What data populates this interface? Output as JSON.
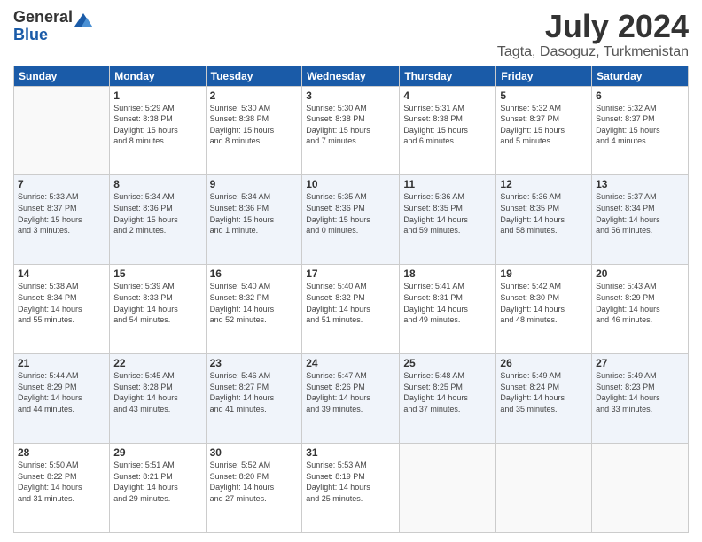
{
  "logo": {
    "general": "General",
    "blue": "Blue"
  },
  "header": {
    "month": "July 2024",
    "location": "Tagta, Dasoguz, Turkmenistan"
  },
  "weekdays": [
    "Sunday",
    "Monday",
    "Tuesday",
    "Wednesday",
    "Thursday",
    "Friday",
    "Saturday"
  ],
  "weeks": [
    [
      {
        "day": "",
        "info": ""
      },
      {
        "day": "1",
        "info": "Sunrise: 5:29 AM\nSunset: 8:38 PM\nDaylight: 15 hours\nand 8 minutes."
      },
      {
        "day": "2",
        "info": "Sunrise: 5:30 AM\nSunset: 8:38 PM\nDaylight: 15 hours\nand 8 minutes."
      },
      {
        "day": "3",
        "info": "Sunrise: 5:30 AM\nSunset: 8:38 PM\nDaylight: 15 hours\nand 7 minutes."
      },
      {
        "day": "4",
        "info": "Sunrise: 5:31 AM\nSunset: 8:38 PM\nDaylight: 15 hours\nand 6 minutes."
      },
      {
        "day": "5",
        "info": "Sunrise: 5:32 AM\nSunset: 8:37 PM\nDaylight: 15 hours\nand 5 minutes."
      },
      {
        "day": "6",
        "info": "Sunrise: 5:32 AM\nSunset: 8:37 PM\nDaylight: 15 hours\nand 4 minutes."
      }
    ],
    [
      {
        "day": "7",
        "info": "Sunrise: 5:33 AM\nSunset: 8:37 PM\nDaylight: 15 hours\nand 3 minutes."
      },
      {
        "day": "8",
        "info": "Sunrise: 5:34 AM\nSunset: 8:36 PM\nDaylight: 15 hours\nand 2 minutes."
      },
      {
        "day": "9",
        "info": "Sunrise: 5:34 AM\nSunset: 8:36 PM\nDaylight: 15 hours\nand 1 minute."
      },
      {
        "day": "10",
        "info": "Sunrise: 5:35 AM\nSunset: 8:36 PM\nDaylight: 15 hours\nand 0 minutes."
      },
      {
        "day": "11",
        "info": "Sunrise: 5:36 AM\nSunset: 8:35 PM\nDaylight: 14 hours\nand 59 minutes."
      },
      {
        "day": "12",
        "info": "Sunrise: 5:36 AM\nSunset: 8:35 PM\nDaylight: 14 hours\nand 58 minutes."
      },
      {
        "day": "13",
        "info": "Sunrise: 5:37 AM\nSunset: 8:34 PM\nDaylight: 14 hours\nand 56 minutes."
      }
    ],
    [
      {
        "day": "14",
        "info": "Sunrise: 5:38 AM\nSunset: 8:34 PM\nDaylight: 14 hours\nand 55 minutes."
      },
      {
        "day": "15",
        "info": "Sunrise: 5:39 AM\nSunset: 8:33 PM\nDaylight: 14 hours\nand 54 minutes."
      },
      {
        "day": "16",
        "info": "Sunrise: 5:40 AM\nSunset: 8:32 PM\nDaylight: 14 hours\nand 52 minutes."
      },
      {
        "day": "17",
        "info": "Sunrise: 5:40 AM\nSunset: 8:32 PM\nDaylight: 14 hours\nand 51 minutes."
      },
      {
        "day": "18",
        "info": "Sunrise: 5:41 AM\nSunset: 8:31 PM\nDaylight: 14 hours\nand 49 minutes."
      },
      {
        "day": "19",
        "info": "Sunrise: 5:42 AM\nSunset: 8:30 PM\nDaylight: 14 hours\nand 48 minutes."
      },
      {
        "day": "20",
        "info": "Sunrise: 5:43 AM\nSunset: 8:29 PM\nDaylight: 14 hours\nand 46 minutes."
      }
    ],
    [
      {
        "day": "21",
        "info": "Sunrise: 5:44 AM\nSunset: 8:29 PM\nDaylight: 14 hours\nand 44 minutes."
      },
      {
        "day": "22",
        "info": "Sunrise: 5:45 AM\nSunset: 8:28 PM\nDaylight: 14 hours\nand 43 minutes."
      },
      {
        "day": "23",
        "info": "Sunrise: 5:46 AM\nSunset: 8:27 PM\nDaylight: 14 hours\nand 41 minutes."
      },
      {
        "day": "24",
        "info": "Sunrise: 5:47 AM\nSunset: 8:26 PM\nDaylight: 14 hours\nand 39 minutes."
      },
      {
        "day": "25",
        "info": "Sunrise: 5:48 AM\nSunset: 8:25 PM\nDaylight: 14 hours\nand 37 minutes."
      },
      {
        "day": "26",
        "info": "Sunrise: 5:49 AM\nSunset: 8:24 PM\nDaylight: 14 hours\nand 35 minutes."
      },
      {
        "day": "27",
        "info": "Sunrise: 5:49 AM\nSunset: 8:23 PM\nDaylight: 14 hours\nand 33 minutes."
      }
    ],
    [
      {
        "day": "28",
        "info": "Sunrise: 5:50 AM\nSunset: 8:22 PM\nDaylight: 14 hours\nand 31 minutes."
      },
      {
        "day": "29",
        "info": "Sunrise: 5:51 AM\nSunset: 8:21 PM\nDaylight: 14 hours\nand 29 minutes."
      },
      {
        "day": "30",
        "info": "Sunrise: 5:52 AM\nSunset: 8:20 PM\nDaylight: 14 hours\nand 27 minutes."
      },
      {
        "day": "31",
        "info": "Sunrise: 5:53 AM\nSunset: 8:19 PM\nDaylight: 14 hours\nand 25 minutes."
      },
      {
        "day": "",
        "info": ""
      },
      {
        "day": "",
        "info": ""
      },
      {
        "day": "",
        "info": ""
      }
    ]
  ]
}
